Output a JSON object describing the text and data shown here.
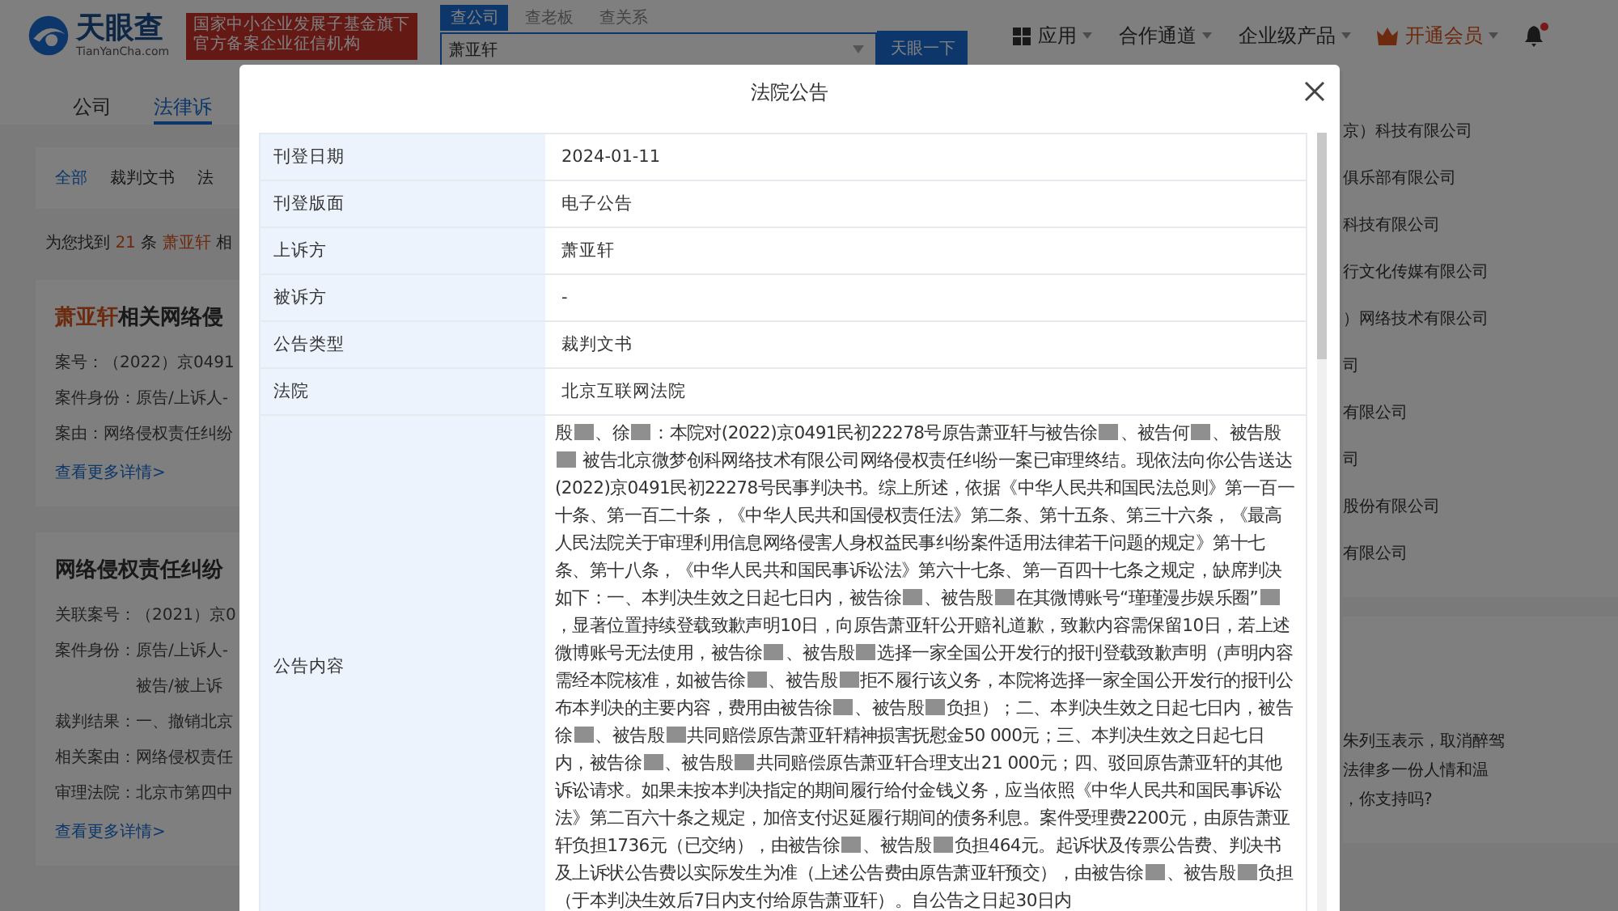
{
  "header": {
    "logo": {
      "name": "天眼查",
      "domain": "TianYanCha.com"
    },
    "badge": [
      "国家中小企业发展子基金旗下",
      "官方备案企业征信机构"
    ],
    "search": {
      "tabs": [
        {
          "label": "查公司",
          "selected": true
        },
        {
          "label": "查老板",
          "selected": false
        },
        {
          "label": "查关系",
          "selected": false
        }
      ],
      "value": "萧亚轩",
      "button": "天眼一下"
    },
    "nav": [
      {
        "kind": "apps",
        "label": "应用"
      },
      {
        "kind": "menu",
        "label": "合作通道"
      },
      {
        "kind": "menu",
        "label": "企业级产品"
      },
      {
        "kind": "vip",
        "label": "开通会员"
      },
      {
        "kind": "bell",
        "unread": true
      }
    ]
  },
  "page": {
    "tabs": [
      {
        "label": "公司",
        "selected": false
      },
      {
        "label": "法律诉",
        "selected": true
      }
    ],
    "filters": [
      {
        "label": "全部",
        "selected": true
      },
      {
        "label": "裁判文书",
        "selected": false
      },
      {
        "label": "法",
        "selected": false
      }
    ],
    "summary": [
      {
        "text": "为您找到 ",
        "highlight": false
      },
      {
        "text": "21",
        "highlight": true
      },
      {
        "text": " 条 ",
        "highlight": false
      },
      {
        "text": "萧亚轩",
        "highlight": true
      },
      {
        "text": " 相",
        "highlight": false
      }
    ],
    "cards": [
      {
        "title": [
          {
            "text": "萧亚轩",
            "highlight": true
          },
          {
            "text": "相关网络侵",
            "highlight": false
          }
        ],
        "fields": [
          {
            "label": "案号：",
            "value": "（2022）京0491"
          },
          {
            "label": "案件身份：",
            "value": "原告/上诉人-"
          },
          {
            "label": "案由：",
            "value": "网络侵权责任纠纷"
          }
        ],
        "link": "查看更多详情>"
      },
      {
        "title": [
          {
            "text": "网络侵权责任纠纷",
            "highlight": false
          }
        ],
        "fields": [
          {
            "label": "关联案号：",
            "value": "（2021）京0"
          },
          {
            "label": "案件身份：",
            "value": "原告/上诉人-"
          },
          {
            "value": "被告/被上诉"
          },
          {
            "label": "裁判结果：",
            "value": "一、撤销北京"
          },
          {
            "label": "相关案由：",
            "value": "网络侵权责任"
          },
          {
            "label": "审理法院：",
            "value": "北京市第四中"
          }
        ],
        "link": "查看更多详情>"
      }
    ],
    "side_list": [
      "京）科技有限公司",
      "俱乐部有限公司",
      "科技有限公司",
      "行文化传媒有限公司",
      "）网络技术有限公司",
      "司",
      "有限公司",
      "司",
      "股份有限公司",
      "有限公司"
    ],
    "side_news": [
      "朱列玉表示，取消醉驾",
      "法律多一份人情和温",
      "，你支持吗?"
    ]
  },
  "modal": {
    "title": "法院公告",
    "rows": [
      {
        "label": "刊登日期",
        "value": "2024-01-11"
      },
      {
        "label": "刊登版面",
        "value": "电子公告"
      },
      {
        "label": "上诉方",
        "value": "萧亚轩"
      },
      {
        "label": "被诉方",
        "value": "-"
      },
      {
        "label": "公告类型",
        "value": "裁判文书"
      },
      {
        "label": "法院",
        "value": "北京互联网法院"
      },
      {
        "label": "公告内容",
        "segments": [
          {
            "kind": "text",
            "text": "殷"
          },
          {
            "kind": "redacted"
          },
          {
            "kind": "text",
            "text": "、徐"
          },
          {
            "kind": "redacted"
          },
          {
            "kind": "text",
            "text": "：本院对(2022)京0491民初22278号原告萧亚轩与被告徐"
          },
          {
            "kind": "redacted"
          },
          {
            "kind": "text",
            "text": "、被告何"
          },
          {
            "kind": "redacted"
          },
          {
            "kind": "text",
            "text": "、被告殷"
          },
          {
            "kind": "redacted"
          },
          {
            "kind": "text",
            "text": " 被告北京微梦创科网络技术有限公司网络侵权责任纠纷一案已审理终结。现依法向你公告送达(2022)京0491民初22278号民事判决书。综上所述，依据《中华人民共和国民法总则》第一百一十条、第一百二十条，《中华人民共和国侵权责任法》第二条、第十五条、第三十六条，《最高人民法院关于审理利用信息网络侵害人身权益民事纠纷案件适用法律若干问题的规定》第十七条、第十八条，《中华人民共和国民事诉讼法》第六十七条、第一百四十七条之规定，缺席判决如下：一、本判决生效之日起七日内，被告徐"
          },
          {
            "kind": "redacted"
          },
          {
            "kind": "text",
            "text": "、被告殷"
          },
          {
            "kind": "redacted"
          },
          {
            "kind": "text",
            "text": "在其微博账号“瑾瑾漫步娱乐圈”"
          },
          {
            "kind": "redacted"
          },
          {
            "kind": "text",
            "text": "，显著位置持续登载致歉声明10日，向原告萧亚轩公开赔礼道歉，致歉内容需保留10日，若上述微博账号无法使用，被告徐"
          },
          {
            "kind": "redacted"
          },
          {
            "kind": "text",
            "text": "、被告殷"
          },
          {
            "kind": "redacted"
          },
          {
            "kind": "text",
            "text": "选择一家全国公开发行的报刊登载致歉声明（声明内容需经本院核准，如被告徐"
          },
          {
            "kind": "redacted"
          },
          {
            "kind": "text",
            "text": "、被告殷"
          },
          {
            "kind": "redacted"
          },
          {
            "kind": "text",
            "text": "拒不履行该义务，本院将选择一家全国公开发行的报刊公布本判决的主要内容，费用由被告徐"
          },
          {
            "kind": "redacted"
          },
          {
            "kind": "text",
            "text": "、被告殷"
          },
          {
            "kind": "redacted"
          },
          {
            "kind": "text",
            "text": "负担）；二、本判决生效之日起七日内，被告徐"
          },
          {
            "kind": "redacted"
          },
          {
            "kind": "text",
            "text": "、被告殷"
          },
          {
            "kind": "redacted"
          },
          {
            "kind": "text",
            "text": "共同赔偿原告萧亚轩精神损害抚慰金50 000元；三、本判决生效之日起七日内，被告徐"
          },
          {
            "kind": "redacted"
          },
          {
            "kind": "text",
            "text": "、被告殷"
          },
          {
            "kind": "redacted"
          },
          {
            "kind": "text",
            "text": "共同赔偿原告萧亚轩合理支出21 000元；四、驳回原告萧亚轩的其他诉讼请求。如果未按本判决指定的期间履行给付金钱义务，应当依照《中华人民共和国民事诉讼法》第二百六十条之规定，加倍支付迟延履行期间的债务利息。案件受理费2200元，由原告萧亚轩负担1736元（已交纳），由被告徐"
          },
          {
            "kind": "redacted"
          },
          {
            "kind": "text",
            "text": "、被告殷"
          },
          {
            "kind": "redacted"
          },
          {
            "kind": "text",
            "text": "负担464元。起诉状及传票公告费、判决书及上诉状公告费以实际发生为准（上述公告费由原告萧亚轩预交），由被告徐"
          },
          {
            "kind": "redacted"
          },
          {
            "kind": "text",
            "text": "、被告殷"
          },
          {
            "kind": "redacted"
          },
          {
            "kind": "text",
            "text": "负担（于本判决生效后7日内支付给原告萧亚轩）。自公告之日起30日内"
          }
        ]
      }
    ]
  }
}
